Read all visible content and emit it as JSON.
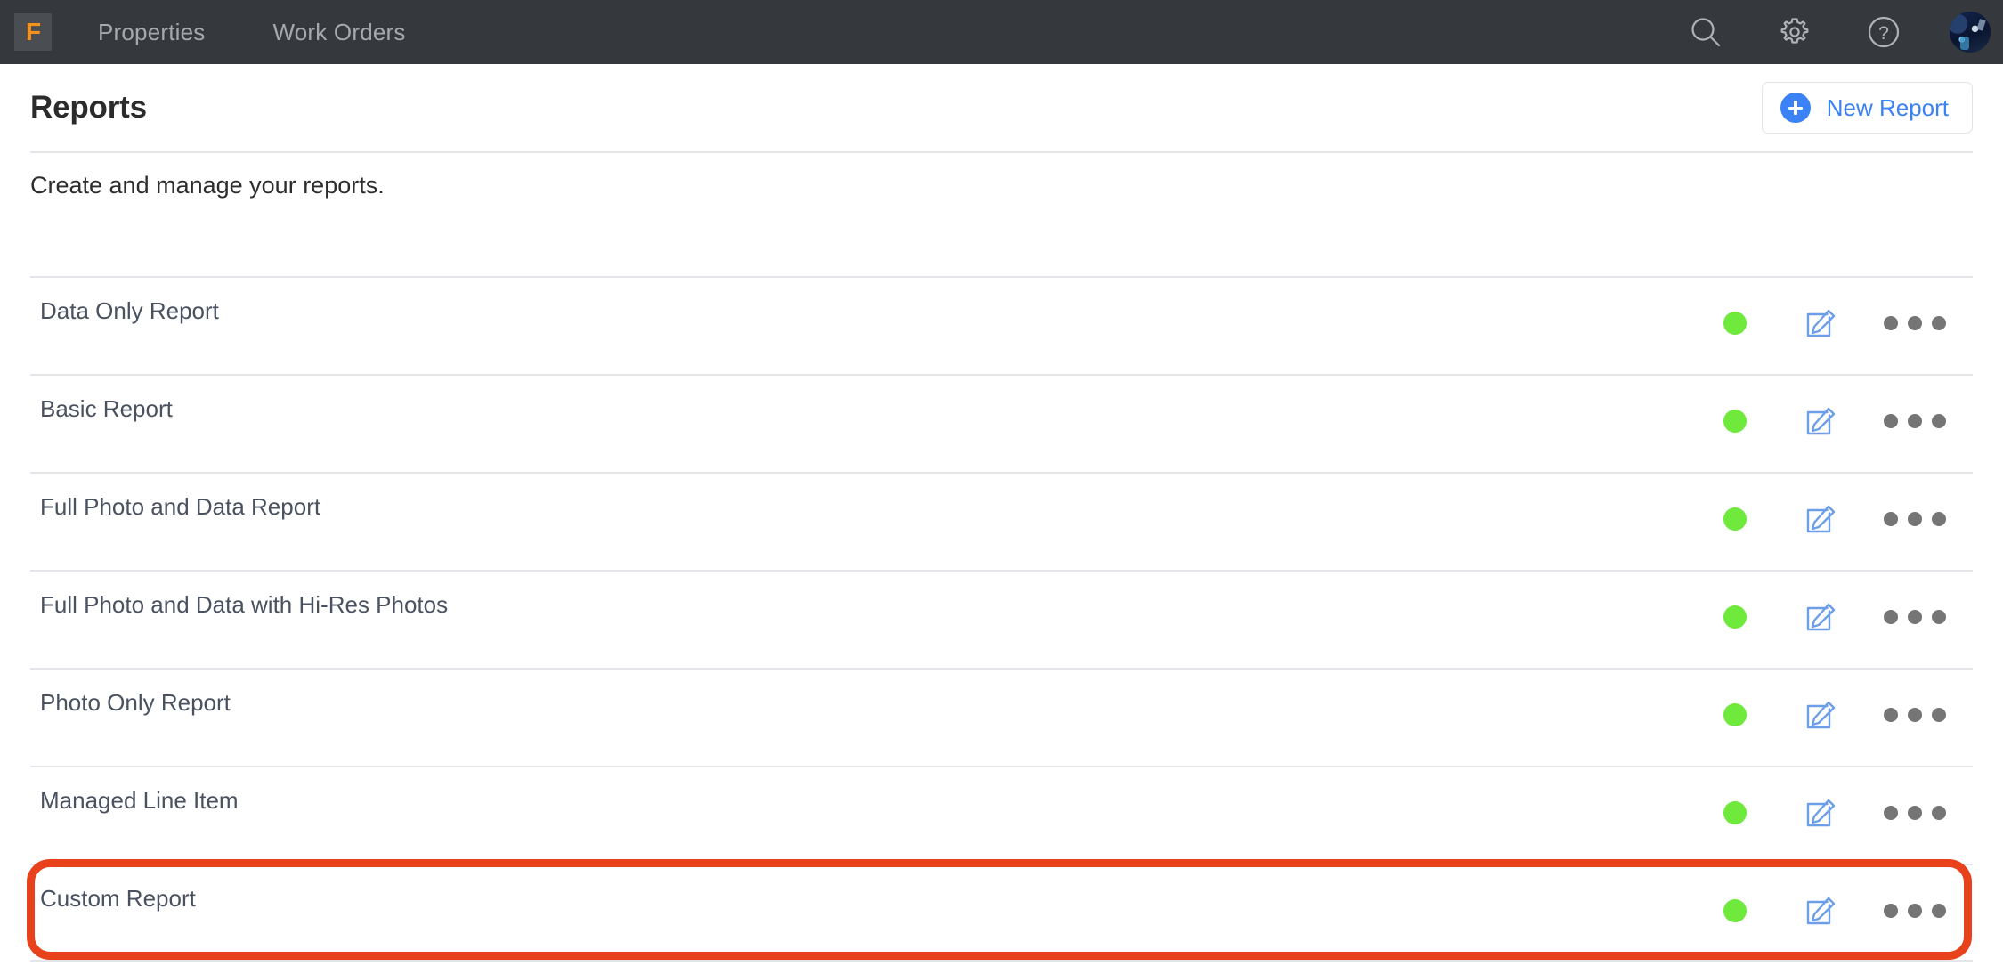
{
  "topnav": {
    "logo_letter": "F",
    "links": [
      {
        "label": "Properties"
      },
      {
        "label": "Work Orders"
      }
    ],
    "icons": [
      {
        "name": "search-icon"
      },
      {
        "name": "gear-icon"
      },
      {
        "name": "help-icon"
      }
    ],
    "background_color": "#35393e",
    "logo_color": "#f5911e"
  },
  "header": {
    "title": "Reports",
    "subtitle": "Create and manage your reports.",
    "new_report_label": "New Report",
    "accent_color": "#3b82f6"
  },
  "reports": [
    {
      "name": "Data Only Report",
      "status": "active",
      "highlighted": false
    },
    {
      "name": "Basic Report",
      "status": "active",
      "highlighted": false
    },
    {
      "name": "Full Photo and Data Report",
      "status": "active",
      "highlighted": false
    },
    {
      "name": "Full Photo and Data with Hi-Res Photos",
      "status": "active",
      "highlighted": false
    },
    {
      "name": "Photo Only Report",
      "status": "active",
      "highlighted": false
    },
    {
      "name": "Managed Line Item",
      "status": "active",
      "highlighted": false
    },
    {
      "name": "Custom Report",
      "status": "active",
      "highlighted": true
    }
  ],
  "colors": {
    "status_active": "#6ee93c",
    "edit_icon": "#6d9ee8",
    "more_icon": "#757575",
    "annotation_highlight": "#e8421d",
    "row_divider": "#e3e5e9",
    "row_text": "#4a5260"
  }
}
